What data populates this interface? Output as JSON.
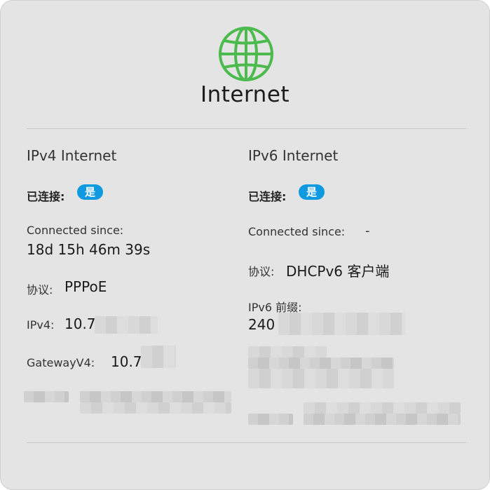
{
  "header": {
    "icon": "globe-icon",
    "title": "Internet",
    "accent_color": "#4cba4c"
  },
  "ipv4": {
    "section_title": "IPv4 Internet",
    "connected_label": "已连接:",
    "connected_value": "是",
    "connected_since_label": "Connected since:",
    "connected_since_value": "18d 15h 46m 39s",
    "protocol_label": "协议:",
    "protocol_value": "PPPoE",
    "ipv4_label": "IPv4:",
    "ipv4_value": "10.7",
    "gateway_label": "GatewayV4:",
    "gateway_value": "10.7"
  },
  "ipv6": {
    "section_title": "IPv6 Internet",
    "connected_label": "已连接:",
    "connected_value": "是",
    "connected_since_label": "Connected since:",
    "connected_since_value": "-",
    "protocol_label": "协议:",
    "protocol_value": "DHCPv6 客户端",
    "prefix_label": "IPv6 前缀:",
    "prefix_value": "240"
  },
  "badge_color": "#0f9ae0"
}
